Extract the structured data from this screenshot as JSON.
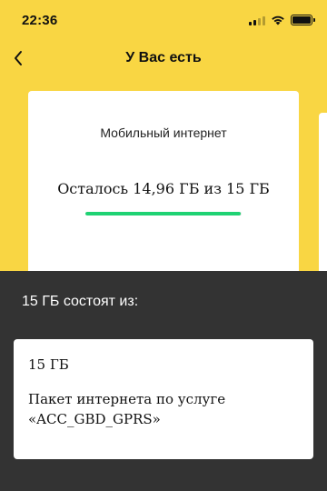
{
  "status_bar": {
    "time": "22:36",
    "icons": [
      "signal-icon",
      "wifi-icon",
      "battery-icon"
    ]
  },
  "nav": {
    "back_icon": "chevron-left-icon",
    "title": "У Вас есть"
  },
  "card": {
    "label": "Мобильный интернет",
    "remaining_text": "Осталось 14,96 ГБ из 15 ГБ",
    "progress_fraction": 0.997
  },
  "sheet": {
    "heading": "15 ГБ состоят из:",
    "package": {
      "size": "15 ГБ",
      "description_line1": "Пакет интернета по услуге",
      "description_line2": "«ACC_GBD_GPRS»"
    }
  },
  "colors": {
    "brand_yellow": "#f9d643",
    "progress_green": "#1fd273",
    "overlay_dark": "#333333"
  }
}
